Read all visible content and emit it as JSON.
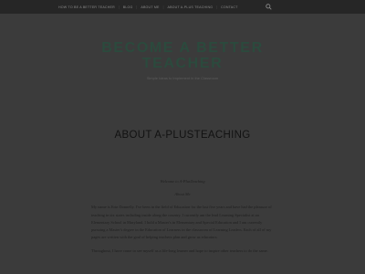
{
  "nav": {
    "items": [
      "HOW TO BE A BETTER TEACHER",
      "BLOG",
      "ABOUT ME",
      "ABOUT A-PLUS TEACHING",
      "CONTACT"
    ]
  },
  "site": {
    "title": "BECOME A BETTER\nTEACHER",
    "tagline": "Simple Ideas to Implement in the Classroom"
  },
  "page": {
    "title": "ABOUT A-PLUSTEACHING",
    "line1": "Welcome to A-PlusTeaching",
    "line2": "About Me",
    "para1": "My name is Erin Donnelly. I've been in the field of Education for the last five years and have had the pleasure of teaching in six states including inside along the country. I currently am the lead Learning Specialist at an Elementary School in Maryland. I hold a Master's in Elementary and Special Education and I am currently pursuing a Master's degree in the Education of Learners in the classroom of Learning Leaders. Each of all of my pages are written with the goal of helping teachers plan and grow as educators.",
    "para2": "Throughout, I have come to see myself as a life-long learner and hope to inspire other teachers to do the same."
  },
  "colors": {
    "background": "#3b3b3b",
    "topbar": "#262626",
    "title": "#2b4a3d"
  }
}
